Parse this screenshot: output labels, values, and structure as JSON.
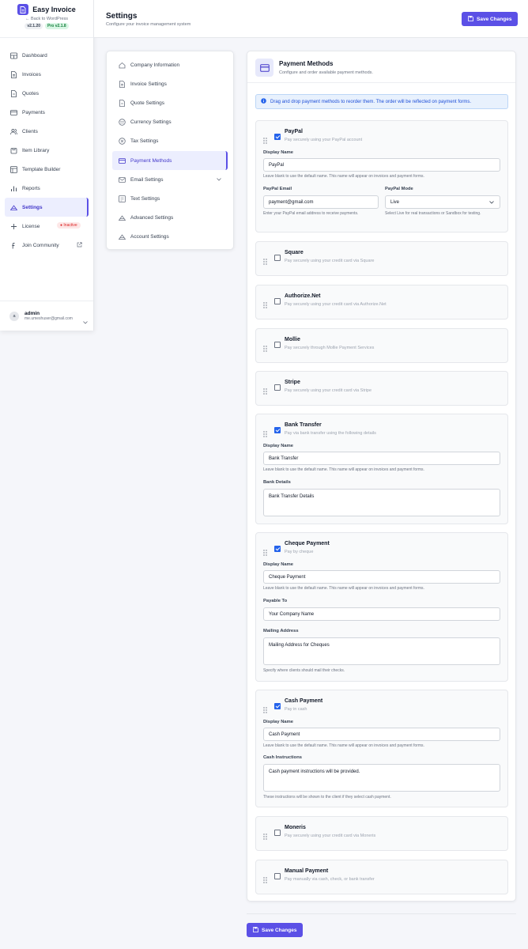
{
  "brand": {
    "name": "Easy Invoice",
    "back_link": "← Back to WordPress",
    "version": "v2.1.20",
    "pro_version": "Pro v2.1.8",
    "color": "#5b50e6"
  },
  "sidebar": {
    "items": [
      {
        "label": "Dashboard",
        "icon": "dashboard-icon"
      },
      {
        "label": "Invoices",
        "icon": "invoice-icon"
      },
      {
        "label": "Quotes",
        "icon": "quote-icon"
      },
      {
        "label": "Payments",
        "icon": "payments-icon"
      },
      {
        "label": "Clients",
        "icon": "clients-icon"
      },
      {
        "label": "Item Library",
        "icon": "item-library-icon"
      },
      {
        "label": "Template Builder",
        "icon": "template-icon"
      },
      {
        "label": "Reports",
        "icon": "reports-icon"
      },
      {
        "label": "Settings",
        "icon": "settings-icon",
        "active": true
      },
      {
        "label": "License",
        "icon": "plus-icon",
        "badge": "Inactive"
      },
      {
        "label": "Join Community",
        "icon": "facebook-icon"
      }
    ]
  },
  "user": {
    "initial": "a",
    "name": "admin",
    "email": "me.umeshuser@gmail.com"
  },
  "header": {
    "title": "Settings",
    "subtitle": "Configure your invoice management system",
    "save_label": "Save Changes"
  },
  "settings_nav": {
    "items": [
      {
        "label": "Company Information"
      },
      {
        "label": "Invoice Settings"
      },
      {
        "label": "Quote Settings"
      },
      {
        "label": "Currency Settings"
      },
      {
        "label": "Tax Settings"
      },
      {
        "label": "Payment Methods",
        "active": true
      },
      {
        "label": "Email Settings",
        "has_children": true
      },
      {
        "label": "Text Settings"
      },
      {
        "label": "Advanced Settings"
      },
      {
        "label": "Account Settings"
      }
    ]
  },
  "panel": {
    "title": "Payment Methods",
    "subtitle": "Configure and order available payment methods.",
    "info": "Drag and drop payment methods to reorder them. The order will be reflected on payment forms."
  },
  "methods": {
    "paypal": {
      "name": "PayPal",
      "desc": "Pay securely using your PayPal account",
      "enabled": true,
      "display_name_label": "Display Name",
      "display_name": "PayPal",
      "display_help": "Leave blank to use the default name. This name will appear on invoices and payment forms.",
      "email_label": "PayPal Email",
      "email": "payment@gmail.com",
      "email_help": "Enter your PayPal email address to receive payments.",
      "mode_label": "PayPal Mode",
      "mode": "Live",
      "mode_help": "Select Live for real transactions or Sandbox for testing."
    },
    "square": {
      "name": "Square",
      "desc": "Pay securely using your credit card via Square",
      "enabled": false
    },
    "authorize": {
      "name": "Authorize.Net",
      "desc": "Pay securely using your credit card via Authorize.Net",
      "enabled": false
    },
    "mollie": {
      "name": "Mollie",
      "desc": "Pay securely through Mollie Payment Services",
      "enabled": false
    },
    "stripe": {
      "name": "Stripe",
      "desc": "Pay securely using your credit card via Stripe",
      "enabled": false
    },
    "bank": {
      "name": "Bank Transfer",
      "desc": "Pay via bank transfer using the following details",
      "enabled": true,
      "display_name_label": "Display Name",
      "display_name": "Bank Transfer",
      "display_help": "Leave blank to use the default name. This name will appear on invoices and payment forms.",
      "details_label": "Bank Details",
      "details": "Bank Transfer Details"
    },
    "cheque": {
      "name": "Cheque Payment",
      "desc": "Pay by cheque",
      "enabled": true,
      "display_name_label": "Display Name",
      "display_name": "Cheque Payment",
      "display_help": "Leave blank to use the default name. This name will appear on invoices and payment forms.",
      "payable_label": "Payable To",
      "payable": "Your Company Name",
      "address_label": "Mailing Address",
      "address": "Mailing Address for Cheques",
      "address_help": "Specify where clients should mail their checks."
    },
    "cash": {
      "name": "Cash Payment",
      "desc": "Pay in cash",
      "enabled": true,
      "display_name_label": "Display Name",
      "display_name": "Cash Payment",
      "display_help": "Leave blank to use the default name. This name will appear on invoices and payment forms.",
      "instructions_label": "Cash Instructions",
      "instructions": "Cash payment instructions will be provided.",
      "instructions_help": "These instructions will be shown to the client if they select cash payment."
    },
    "moneris": {
      "name": "Moneris",
      "desc": "Pay securely using your credit card via Moneris",
      "enabled": false
    },
    "manual": {
      "name": "Manual Payment",
      "desc": "Pay manually via cash, check, or bank transfer",
      "enabled": false
    }
  },
  "footer": {
    "save_label": "Save Changes"
  }
}
